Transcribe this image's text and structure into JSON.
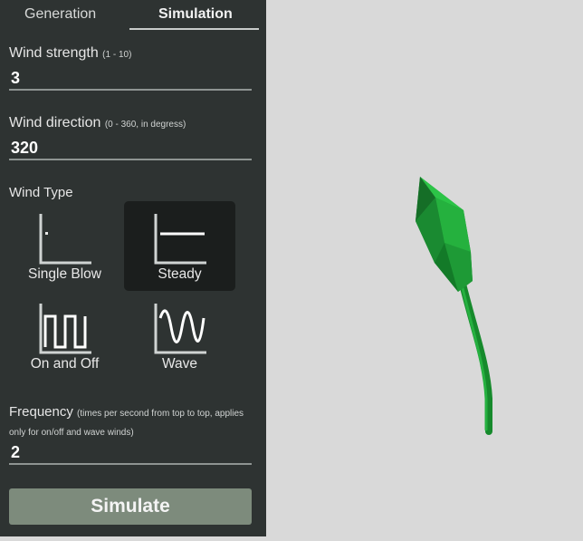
{
  "tabs": {
    "generation": "Generation",
    "simulation": "Simulation",
    "active": "Simulation"
  },
  "wind_strength": {
    "label": "Wind strength",
    "hint": "(1 - 10)",
    "value": "3"
  },
  "wind_direction": {
    "label": "Wind direction",
    "hint": "(0 - 360, in degress)",
    "value": "320"
  },
  "wind_type": {
    "label": "Wind Type",
    "selected": "Steady",
    "options": [
      {
        "label": "Single Blow",
        "icon": "single-blow-icon"
      },
      {
        "label": "Steady",
        "icon": "steady-icon"
      },
      {
        "label": "On and Off",
        "icon": "on-and-off-icon"
      },
      {
        "label": "Wave",
        "icon": "wave-icon"
      }
    ]
  },
  "frequency": {
    "label": "Frequency",
    "hint": "(times per second from top to top, applies only for on/off and wave winds)",
    "value": "2"
  },
  "simulate_button": "Simulate",
  "colors": {
    "panel": "#2e3332",
    "viewport": "#d9d9d9",
    "button": "#7d8b7c",
    "plant_green": "#1f9a35"
  }
}
